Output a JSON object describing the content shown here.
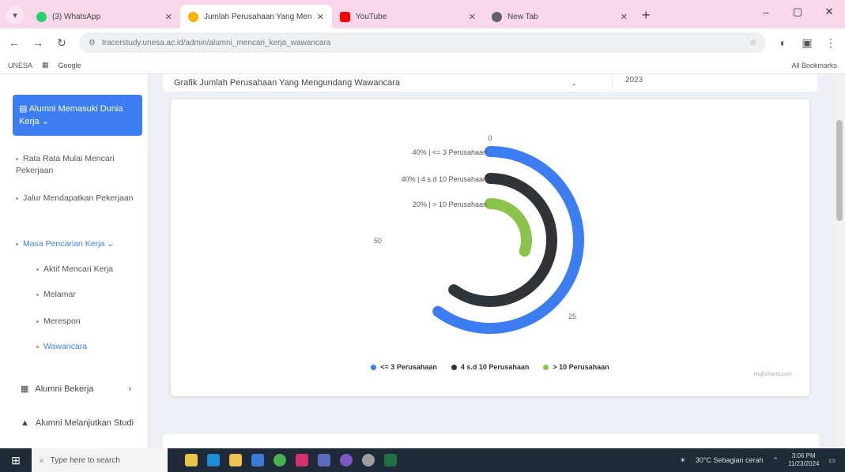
{
  "browser": {
    "tabs": [
      {
        "title": "(3) WhatsApp",
        "color": "#25d366",
        "active": false
      },
      {
        "title": "Jumlah Perusahaan Yang Meng",
        "color": "#f4b400",
        "active": true
      },
      {
        "title": "YouTube",
        "color": "#ff0000",
        "active": false
      },
      {
        "title": "New Tab",
        "color": "#5f6368",
        "active": false
      }
    ],
    "url": "tracerstudy.unesa.ac.id/admin/alumni_mencari_kerja_wawancara",
    "bookmarks": [
      "UNESA",
      "Google"
    ],
    "all_bookmarks": "All Bookmarks"
  },
  "sidebar": {
    "active_section": "Alumni Memasuki Dunia Kerja",
    "items": [
      "Rata Rata Mulai Mencari Pekerjaan",
      "Jalur Mendapatkan Pekerjaan",
      "Masa Pencarian Kerja"
    ],
    "subitems": [
      "Aktif Mencari Kerja",
      "Melamar",
      "Merespon",
      "Wawancara"
    ],
    "bottom": [
      "Alumni Bekerja",
      "Alumni Melanjutkan Studi"
    ]
  },
  "header": {
    "select_title": "Grafik Jumlah Perusahaan Yang Mengundang Wawancara",
    "select2": "2023"
  },
  "chart_data": {
    "type": "radialBar",
    "max": 100,
    "tick_labels": [
      "0",
      "25",
      "50"
    ],
    "series": [
      {
        "label": "40% | <= 3 Perusahaan",
        "value": 40,
        "color": "#3d7df2"
      },
      {
        "label": "40% | 4 s.d 10 Perusahaan",
        "value": 40,
        "color": "#2f3438"
      },
      {
        "label": "20% | > 10 Perusahaan",
        "value": 20,
        "color": "#8bc34a"
      }
    ],
    "legend": [
      "<= 3 Perusahaan",
      "4 s.d 10 Perusahaan",
      "> 10 Perusahaan"
    ],
    "credit": "Highcharts.com"
  },
  "taskbar": {
    "search_placeholder": "Type here to search",
    "weather": "30°C  Sebagian cerah",
    "time": "3:06 PM",
    "date": "11/23/2024"
  }
}
